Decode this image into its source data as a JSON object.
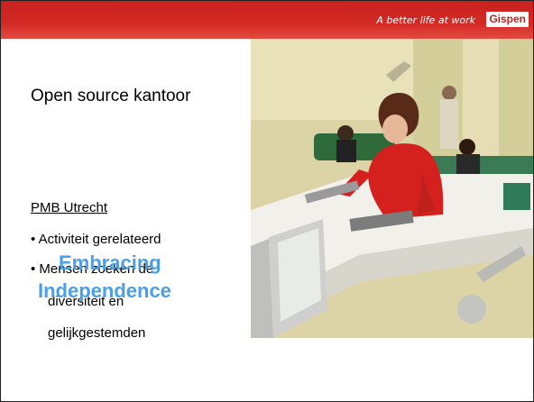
{
  "header": {
    "tagline": "A better life at work",
    "brand": "Gispen"
  },
  "slide": {
    "title": "Open source kantoor",
    "subheading": "PMB Utrecht",
    "bullets": [
      "• Activiteit gerelateerd",
      "• Mensen zoeken de",
      "diversiteit en",
      "gelijkgestemden"
    ],
    "watermark": [
      "Embracing",
      "Independence"
    ]
  },
  "colors": {
    "header_red": "#c8201e",
    "watermark_blue": "#4aa0e8"
  },
  "photo": {
    "description_icon": "office-photo"
  }
}
